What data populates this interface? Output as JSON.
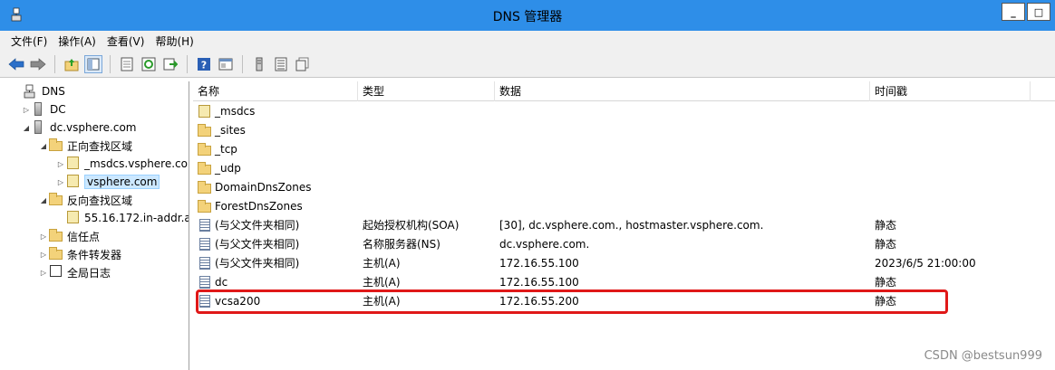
{
  "window": {
    "title": "DNS 管理器"
  },
  "menu": [
    "文件(F)",
    "操作(A)",
    "查看(V)",
    "帮助(H)"
  ],
  "toolbar": {
    "icons": [
      "back-arrow-icon",
      "forward-arrow-icon",
      "up-folder-icon",
      "show-tree-icon",
      "properties-icon",
      "refresh-icon",
      "export-icon",
      "help-icon",
      "console-icon",
      "server-icon",
      "record-list-icon",
      "copy-icon"
    ]
  },
  "tree": [
    {
      "label": "DNS",
      "icon": "dns-icon",
      "level": 0,
      "expander": ""
    },
    {
      "label": "DC",
      "icon": "server-icon",
      "level": 1,
      "expander": "▷"
    },
    {
      "label": "dc.vsphere.com",
      "icon": "server-icon",
      "level": 1,
      "expander": "◢"
    },
    {
      "label": "正向查找区域",
      "icon": "folder-icon",
      "level": 2,
      "expander": "◢"
    },
    {
      "label": "_msdcs.vsphere.cor",
      "icon": "zone-icon",
      "level": 3,
      "expander": "▷"
    },
    {
      "label": "vsphere.com",
      "icon": "zone-icon",
      "level": 3,
      "expander": "▷",
      "selected": true
    },
    {
      "label": "反向查找区域",
      "icon": "folder-icon",
      "level": 2,
      "expander": "◢"
    },
    {
      "label": "55.16.172.in-addr.a",
      "icon": "zone-icon",
      "level": 3,
      "expander": ""
    },
    {
      "label": "信任点",
      "icon": "folder-icon",
      "level": 2,
      "expander": "▷"
    },
    {
      "label": "条件转发器",
      "icon": "folder-icon",
      "level": 2,
      "expander": "▷"
    },
    {
      "label": "全局日志",
      "icon": "log-icon",
      "level": 2,
      "expander": "▷"
    }
  ],
  "columns": {
    "name": "名称",
    "type": "类型",
    "data": "数据",
    "timestamp": "时间戳"
  },
  "records": [
    {
      "name": "_msdcs",
      "icon": "zone-icon",
      "type": "",
      "data": "",
      "timestamp": ""
    },
    {
      "name": "_sites",
      "icon": "folder-icon",
      "type": "",
      "data": "",
      "timestamp": ""
    },
    {
      "name": "_tcp",
      "icon": "folder-icon",
      "type": "",
      "data": "",
      "timestamp": ""
    },
    {
      "name": "_udp",
      "icon": "folder-icon",
      "type": "",
      "data": "",
      "timestamp": ""
    },
    {
      "name": "DomainDnsZones",
      "icon": "folder-icon",
      "type": "",
      "data": "",
      "timestamp": ""
    },
    {
      "name": "ForestDnsZones",
      "icon": "folder-icon",
      "type": "",
      "data": "",
      "timestamp": ""
    },
    {
      "name": "(与父文件夹相同)",
      "icon": "record-icon",
      "type": "起始授权机构(SOA)",
      "data": "[30], dc.vsphere.com., hostmaster.vsphere.com.",
      "timestamp": "静态"
    },
    {
      "name": "(与父文件夹相同)",
      "icon": "record-icon",
      "type": "名称服务器(NS)",
      "data": "dc.vsphere.com.",
      "timestamp": "静态"
    },
    {
      "name": "(与父文件夹相同)",
      "icon": "record-icon",
      "type": "主机(A)",
      "data": "172.16.55.100",
      "timestamp": "2023/6/5 21:00:00"
    },
    {
      "name": "dc",
      "icon": "record-icon",
      "type": "主机(A)",
      "data": "172.16.55.100",
      "timestamp": "静态"
    },
    {
      "name": "vcsa200",
      "icon": "record-icon",
      "type": "主机(A)",
      "data": "172.16.55.200",
      "timestamp": "静态",
      "highlighted": true
    }
  ],
  "watermark": "CSDN @bestsun999",
  "colors": {
    "titlebar": "#2e8ee8",
    "highlight": "#e01818",
    "selected": "#cce8ff"
  }
}
